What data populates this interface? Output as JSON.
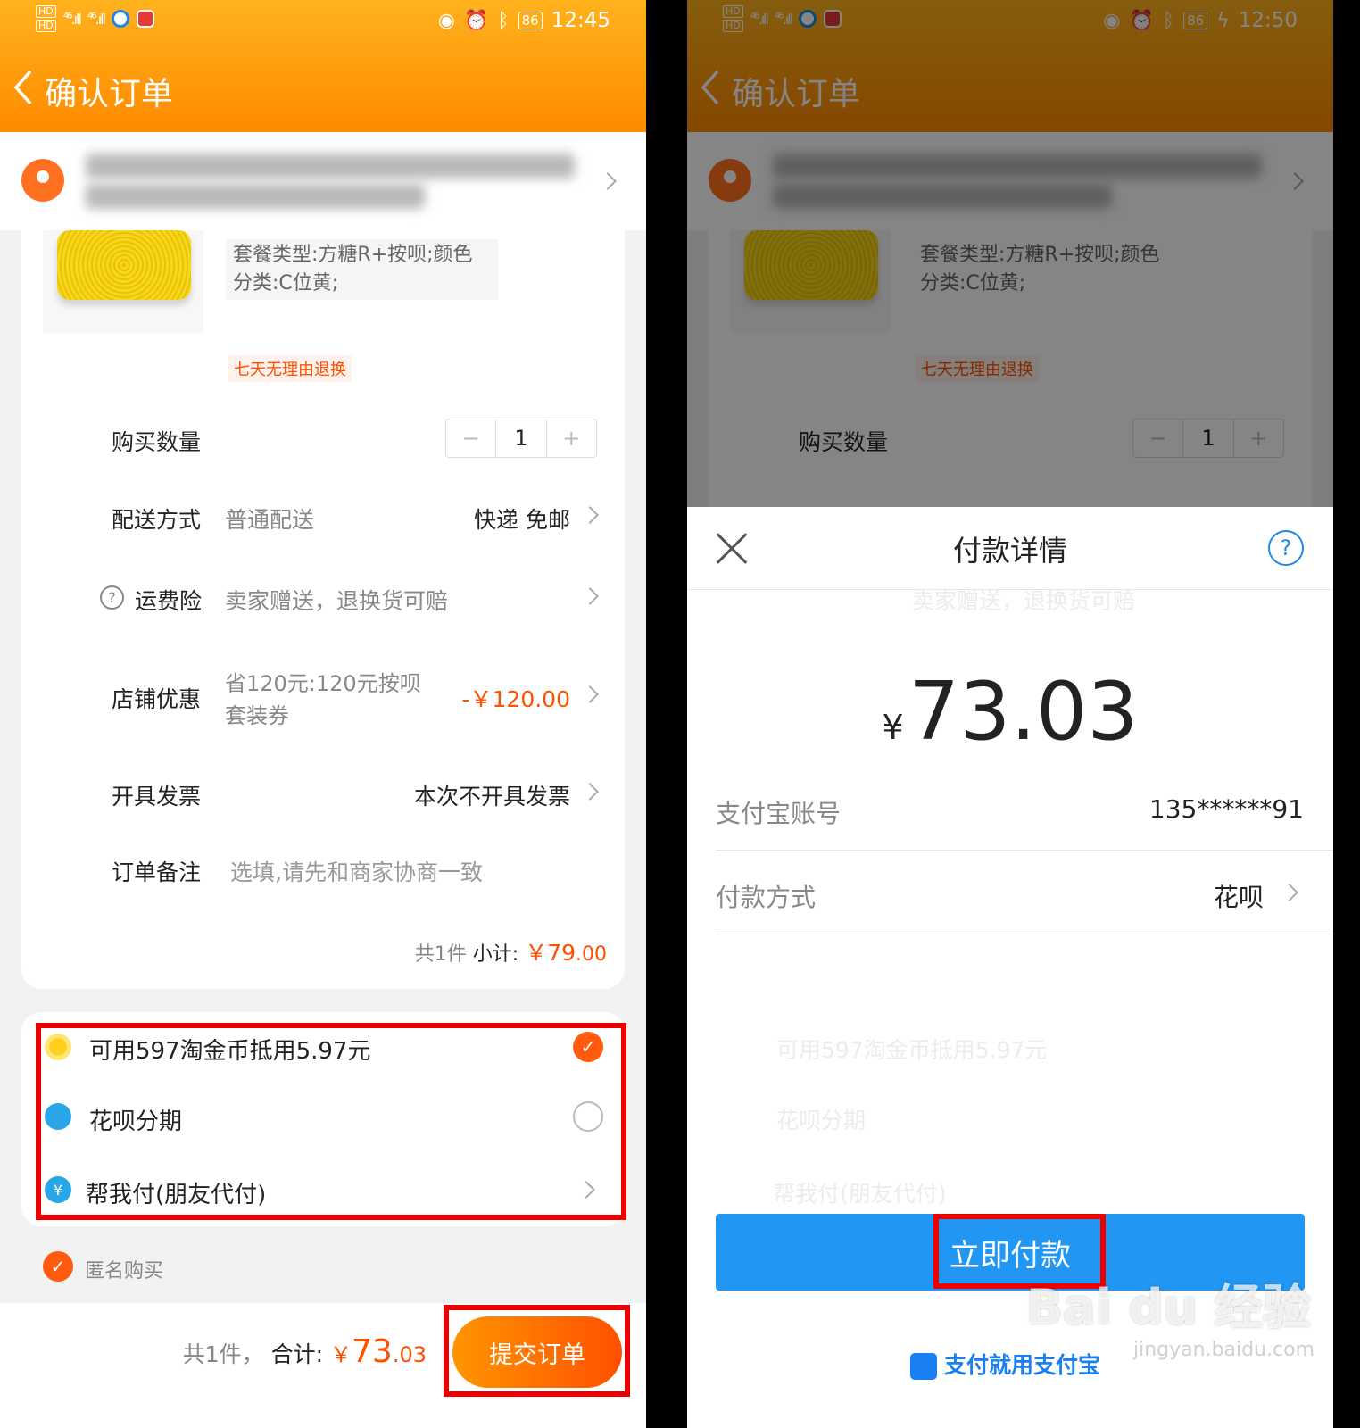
{
  "left": {
    "status": {
      "hd1": "HD",
      "hd2": "HD",
      "sig1": "46",
      "sig2": "46",
      "battery": "86",
      "time": "12:45"
    },
    "header": {
      "title": "确认订单"
    },
    "product": {
      "spec": "套餐类型:方糖R+按呗;颜色分类:C位黄;",
      "tag": "七天无理由退换"
    },
    "qty": {
      "label": "购买数量",
      "minus": "−",
      "value": "1",
      "plus": "+"
    },
    "delivery": {
      "label": "配送方式",
      "value": "普通配送",
      "right": "快递 免邮"
    },
    "insurance": {
      "icon": "?",
      "label": "运费险",
      "value": "卖家赠送，退换货可赔"
    },
    "discount": {
      "label": "店铺优惠",
      "value1": "省120元:120元按呗",
      "value2": "套装券",
      "amount": "-￥120.00"
    },
    "invoice": {
      "label": "开具发票",
      "right": "本次不开具发票"
    },
    "note": {
      "label": "订单备注",
      "placeholder": "选填,请先和商家协商一致"
    },
    "subtotal": {
      "count": "共1件",
      "label": "小计:",
      "amount": "￥79",
      "decimals": ".00"
    },
    "pay_options": [
      {
        "label": "可用597淘金币抵用5.97元",
        "icon": "coin-icon",
        "state": "checked"
      },
      {
        "label": "花呗分期",
        "icon": "huabei-icon",
        "state": "unchecked"
      },
      {
        "label": "帮我付(朋友代付)",
        "icon": "friend-pay-icon",
        "state": "arrow"
      }
    ],
    "anonymous": {
      "label": "匿名购买"
    },
    "footer": {
      "count": "共1件，",
      "total_label": "合计:",
      "currency": "￥",
      "int": "73",
      "dec": ".03",
      "submit": "提交订单"
    },
    "colors": {
      "header_top": "#ffb21c",
      "header_bottom": "#ff8a00",
      "accent": "#ff5000",
      "highlight": "#ee0000"
    }
  },
  "right": {
    "status": {
      "hd1": "HD",
      "hd2": "HD",
      "sig1": "46",
      "sig2": "46",
      "battery": "86",
      "time": "12:50"
    },
    "sheet": {
      "title": "付款详情",
      "help": "?",
      "currency": "¥",
      "amount": "73.03",
      "account_label": "支付宝账号",
      "account_value": "135******91",
      "method_label": "付款方式",
      "method_value": "花呗",
      "pay_button": "立即付款",
      "brand": "支付就用支付宝"
    },
    "watermark": {
      "text": "Bai du 经验",
      "url": "jingyan.baidu.com"
    },
    "colors": {
      "primary": "#2196f3",
      "highlight": "#ee0000"
    }
  }
}
